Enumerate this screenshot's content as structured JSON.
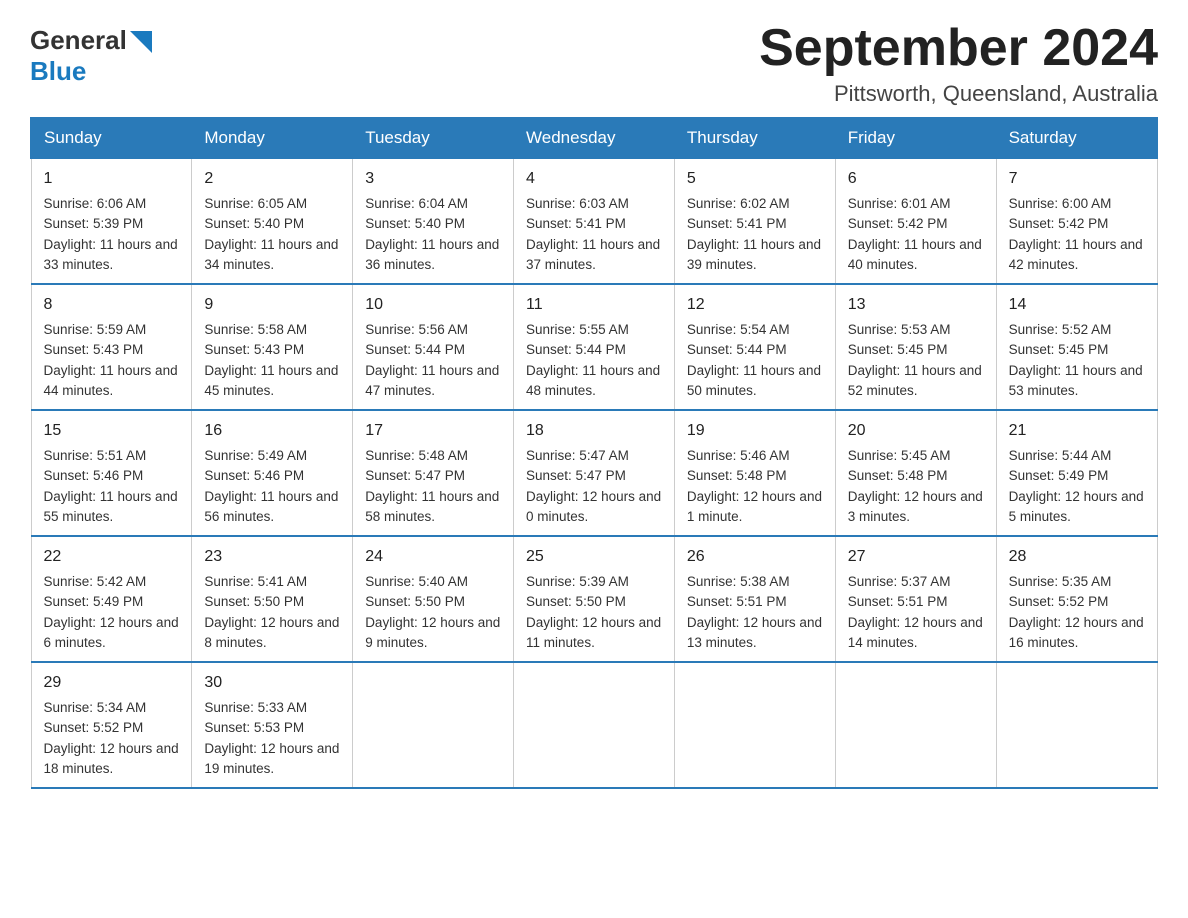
{
  "header": {
    "logo_general": "General",
    "logo_blue": "Blue",
    "title": "September 2024",
    "location": "Pittsworth, Queensland, Australia"
  },
  "days_of_week": [
    "Sunday",
    "Monday",
    "Tuesday",
    "Wednesday",
    "Thursday",
    "Friday",
    "Saturday"
  ],
  "weeks": [
    [
      {
        "day": "1",
        "sunrise": "6:06 AM",
        "sunset": "5:39 PM",
        "daylight": "11 hours and 33 minutes."
      },
      {
        "day": "2",
        "sunrise": "6:05 AM",
        "sunset": "5:40 PM",
        "daylight": "11 hours and 34 minutes."
      },
      {
        "day": "3",
        "sunrise": "6:04 AM",
        "sunset": "5:40 PM",
        "daylight": "11 hours and 36 minutes."
      },
      {
        "day": "4",
        "sunrise": "6:03 AM",
        "sunset": "5:41 PM",
        "daylight": "11 hours and 37 minutes."
      },
      {
        "day": "5",
        "sunrise": "6:02 AM",
        "sunset": "5:41 PM",
        "daylight": "11 hours and 39 minutes."
      },
      {
        "day": "6",
        "sunrise": "6:01 AM",
        "sunset": "5:42 PM",
        "daylight": "11 hours and 40 minutes."
      },
      {
        "day": "7",
        "sunrise": "6:00 AM",
        "sunset": "5:42 PM",
        "daylight": "11 hours and 42 minutes."
      }
    ],
    [
      {
        "day": "8",
        "sunrise": "5:59 AM",
        "sunset": "5:43 PM",
        "daylight": "11 hours and 44 minutes."
      },
      {
        "day": "9",
        "sunrise": "5:58 AM",
        "sunset": "5:43 PM",
        "daylight": "11 hours and 45 minutes."
      },
      {
        "day": "10",
        "sunrise": "5:56 AM",
        "sunset": "5:44 PM",
        "daylight": "11 hours and 47 minutes."
      },
      {
        "day": "11",
        "sunrise": "5:55 AM",
        "sunset": "5:44 PM",
        "daylight": "11 hours and 48 minutes."
      },
      {
        "day": "12",
        "sunrise": "5:54 AM",
        "sunset": "5:44 PM",
        "daylight": "11 hours and 50 minutes."
      },
      {
        "day": "13",
        "sunrise": "5:53 AM",
        "sunset": "5:45 PM",
        "daylight": "11 hours and 52 minutes."
      },
      {
        "day": "14",
        "sunrise": "5:52 AM",
        "sunset": "5:45 PM",
        "daylight": "11 hours and 53 minutes."
      }
    ],
    [
      {
        "day": "15",
        "sunrise": "5:51 AM",
        "sunset": "5:46 PM",
        "daylight": "11 hours and 55 minutes."
      },
      {
        "day": "16",
        "sunrise": "5:49 AM",
        "sunset": "5:46 PM",
        "daylight": "11 hours and 56 minutes."
      },
      {
        "day": "17",
        "sunrise": "5:48 AM",
        "sunset": "5:47 PM",
        "daylight": "11 hours and 58 minutes."
      },
      {
        "day": "18",
        "sunrise": "5:47 AM",
        "sunset": "5:47 PM",
        "daylight": "12 hours and 0 minutes."
      },
      {
        "day": "19",
        "sunrise": "5:46 AM",
        "sunset": "5:48 PM",
        "daylight": "12 hours and 1 minute."
      },
      {
        "day": "20",
        "sunrise": "5:45 AM",
        "sunset": "5:48 PM",
        "daylight": "12 hours and 3 minutes."
      },
      {
        "day": "21",
        "sunrise": "5:44 AM",
        "sunset": "5:49 PM",
        "daylight": "12 hours and 5 minutes."
      }
    ],
    [
      {
        "day": "22",
        "sunrise": "5:42 AM",
        "sunset": "5:49 PM",
        "daylight": "12 hours and 6 minutes."
      },
      {
        "day": "23",
        "sunrise": "5:41 AM",
        "sunset": "5:50 PM",
        "daylight": "12 hours and 8 minutes."
      },
      {
        "day": "24",
        "sunrise": "5:40 AM",
        "sunset": "5:50 PM",
        "daylight": "12 hours and 9 minutes."
      },
      {
        "day": "25",
        "sunrise": "5:39 AM",
        "sunset": "5:50 PM",
        "daylight": "12 hours and 11 minutes."
      },
      {
        "day": "26",
        "sunrise": "5:38 AM",
        "sunset": "5:51 PM",
        "daylight": "12 hours and 13 minutes."
      },
      {
        "day": "27",
        "sunrise": "5:37 AM",
        "sunset": "5:51 PM",
        "daylight": "12 hours and 14 minutes."
      },
      {
        "day": "28",
        "sunrise": "5:35 AM",
        "sunset": "5:52 PM",
        "daylight": "12 hours and 16 minutes."
      }
    ],
    [
      {
        "day": "29",
        "sunrise": "5:34 AM",
        "sunset": "5:52 PM",
        "daylight": "12 hours and 18 minutes."
      },
      {
        "day": "30",
        "sunrise": "5:33 AM",
        "sunset": "5:53 PM",
        "daylight": "12 hours and 19 minutes."
      },
      null,
      null,
      null,
      null,
      null
    ]
  ],
  "labels": {
    "sunrise": "Sunrise:",
    "sunset": "Sunset:",
    "daylight": "Daylight:"
  }
}
